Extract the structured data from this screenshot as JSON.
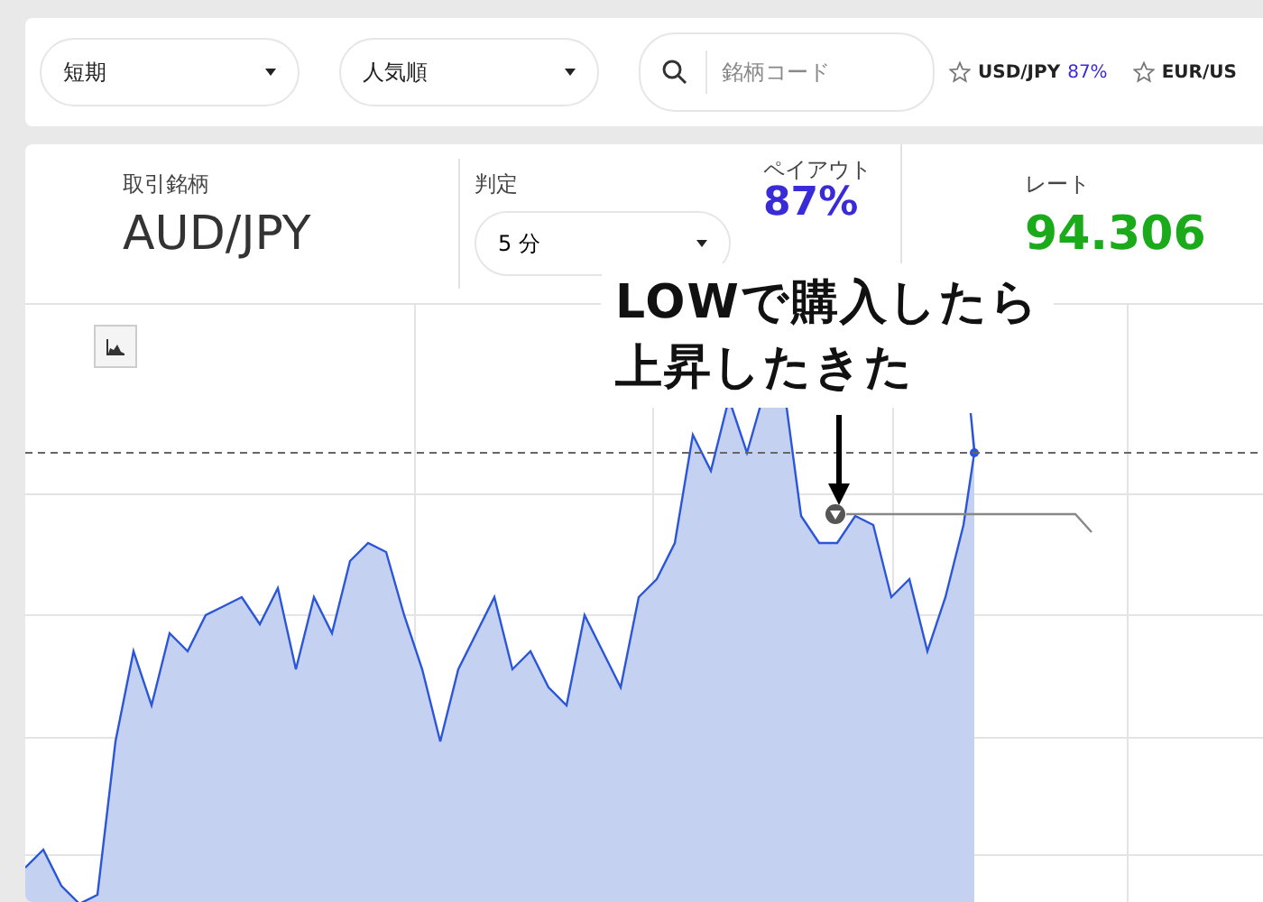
{
  "filters": [
    {
      "label": "短期"
    },
    {
      "label": "人気順"
    }
  ],
  "search": {
    "placeholder": "銘柄コード"
  },
  "favorites": [
    {
      "pair": "USD/JPY",
      "payout": "87%"
    },
    {
      "pair": "EUR/US"
    }
  ],
  "info": {
    "pair_label": "取引銘柄",
    "pair": "AUD/JPY",
    "judge_label": "判定",
    "judge": "5 分",
    "payout_label": "ペイアウト",
    "payout": "87%",
    "rate_label": "レート",
    "rate": "94.306"
  },
  "annotation": {
    "lines": [
      "LOWで購入したら",
      "上昇したきた"
    ]
  }
}
